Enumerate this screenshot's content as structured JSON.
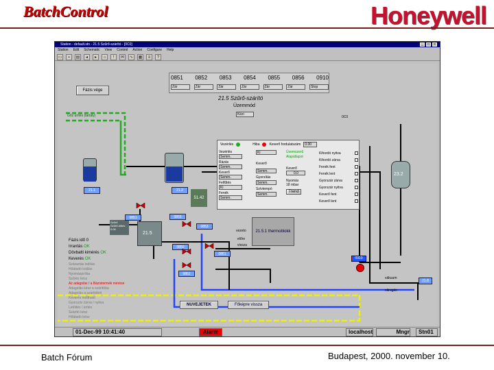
{
  "header": {
    "brand_left": "BatchControl",
    "brand_right": "Honeywell"
  },
  "footer": {
    "left": "Batch Fórum",
    "right": "Budapest, 2000. november 10."
  },
  "window": {
    "title": "Station - default.stn - 21.5 Szűrő-szárító - [0C0]",
    "menu": [
      "Station",
      "Edit",
      "Schematic",
      "View",
      "Control",
      "Action",
      "Configure",
      "Help"
    ],
    "toolbar_icons": [
      "open-icon",
      "save-icon",
      "print-icon",
      "back-icon",
      "forward-icon",
      "home-icon",
      "alarm-icon",
      "message-icon",
      "trend-icon",
      "group-icon",
      "detail-icon",
      "help-icon"
    ]
  },
  "unit_headers": [
    "0851",
    "0852",
    "0853",
    "0854",
    "0855",
    "0856",
    "0910"
  ],
  "unit_states": [
    "Zár",
    "Zár",
    "Zár",
    "Zár",
    "Zár",
    "Zár",
    "Stop"
  ],
  "process": {
    "close_button": "Fázis vége",
    "title": "21.5 Szűrő-szárító",
    "mode_label": "Üzemmód",
    "mode_value": "Kézi",
    "to_evaporator": "Gőz ürítés (tartály)",
    "tank_left_tag": "21.1",
    "tank_mid_tag": "21.2",
    "tank_right_tag": "23.2",
    "value_box": "51.42",
    "ring_label": "0C0",
    "filter_tag": "21.5",
    "valve_tags": [
      "0851",
      "0855",
      "0853",
      "0850",
      "0851",
      "0852"
    ],
    "red_tag": "0910",
    "thermo_block": "21.5.1 thermoblokk",
    "line_labels": {
      "vezeto": "vezeto",
      "elore": "előre",
      "vissza": "vissza",
      "vakuum": "vákuum",
      "nitrogen": "nitrogén"
    },
    "out_tag": "21.8",
    "info_box": [
      "Szűrő",
      "Szűrő-töltés",
      "0.00"
    ]
  },
  "control_panel": {
    "header": [
      {
        "label": "Vezérlés",
        "value": ""
      },
      {
        "label": "Hiba",
        "value": ""
      },
      {
        "label": "Keverő fordulatszám",
        "value": "0.00"
      }
    ],
    "rows": [
      {
        "label": "Vezérlés",
        "value": "Semm."
      },
      {
        "label": "Rázás",
        "value": "Semm."
      },
      {
        "label": "Keverő",
        "value": "Semm."
      },
      {
        "label": "Felfűtés",
        "value": "Ki"
      },
      {
        "label": "Fenék",
        "value": "Semm."
      }
    ],
    "mid": [
      {
        "label": "",
        "value": "Ki"
      },
      {
        "label": "Keverő",
        "value": ""
      },
      {
        "label": "",
        "value": "Semm."
      },
      {
        "label": "Gyorsítás",
        "value": "Semm."
      },
      {
        "label": "Szívtempó",
        "value": "Semm."
      }
    ],
    "status_green": [
      "Üzemszerű",
      "Alapállapot"
    ],
    "readouts": [
      {
        "label": "Keverő",
        "value": "0.0"
      },
      {
        "label": "Nyomás",
        "value": "18"
      },
      {
        "label": "",
        "value": "Trend"
      }
    ],
    "right_labels": [
      "Kihordó nyitva",
      "Kihordó zárva",
      "Fenék fent",
      "Fenék lent",
      "Gyorszár zárva",
      "Gyorszár nyitva",
      "Keverő fent",
      "Keverő lent"
    ],
    "unit_suffix": "mbar"
  },
  "left_status": {
    "lines": [
      {
        "label": "Fázis idő",
        "value": "0"
      },
      {
        "label": "Irrantás",
        "value": "OK"
      },
      {
        "label": "Dövbatti kimérés",
        "value": "OK"
      },
      {
        "label": "Keverés",
        "value": "OK"
      }
    ],
    "grey_lines": [
      "Száraztás indítás",
      "Hőátadó leállás",
      "Nyomáspróba",
      "Szűrés kész"
    ],
    "red_line": "Az adagolás / a Bázistermék mérése",
    "grey_lines2": [
      "Adagolás kész a szárítóba",
      "Adagolás a szárítóból",
      "Keverés indítható",
      "Gyorszár zárva / nyitva",
      "Letöltés / ürítés",
      "Szárító kész",
      "Hőátadó kész"
    ]
  },
  "buttons": {
    "new_batch": "NUVEJETEK",
    "back": "Főképre vissza"
  },
  "statusbar": {
    "datetime": "01-Dec-99 10:41:40",
    "alarm": "Alarm",
    "host": "localhost",
    "station": "Stn01",
    "user": "Mngr"
  },
  "colors": {
    "pipe_black": "#000000",
    "pipe_yellow": "#f0f000",
    "pipe_blue": "#2244ff",
    "pipe_green": "#22aa22",
    "alarm_red": "#ff0000",
    "title_blue": "#00007a"
  }
}
